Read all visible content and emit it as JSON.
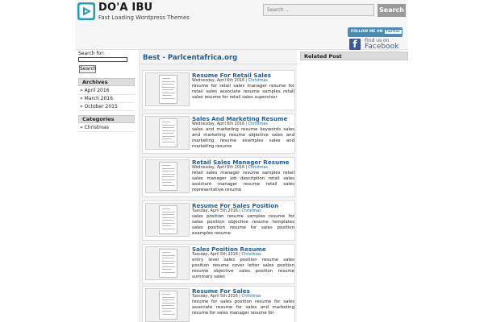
{
  "header": {
    "site_title": "DO'A IBU",
    "tagline": "Fast Loading Wordpress Themes",
    "search_placeholder": "Search ...",
    "search_button": "Search",
    "twitter_follow": "FOLLOW ME ON",
    "twitter_brand": "twitter",
    "facebook_findus": "Find us on",
    "facebook_word": "Facebook",
    "facebook_letter": "f"
  },
  "sidebar_left": {
    "search_label": "Search for:",
    "search_button": "Search",
    "archives": {
      "title": "Archives",
      "items": [
        "» April 2016",
        "» March 2016",
        "» October 2015"
      ]
    },
    "categories": {
      "title": "Categories",
      "items": [
        "» Christmas"
      ]
    }
  },
  "main": {
    "title": "Best - Parlcentafrica.org",
    "posts": [
      {
        "title": "Resume For Retail Sales",
        "date": "Wednesday, April 6th 2016",
        "category": "Christmas",
        "excerpt": "resume for retail sales manager resume for retail sales associate resume samples retail sales resume for retail sales supervisor"
      },
      {
        "title": "Sales And Marketing Resume",
        "date": "Wednesday, April 6th 2016",
        "category": "Christmas",
        "excerpt": "sales and marketing resume keywords sales and marketing resume objective sales and marketing resume examples sales and marketing resume"
      },
      {
        "title": "Retail Sales Manager Resume",
        "date": "Wednesday, April 6th 2016",
        "category": "Christmas",
        "excerpt": "retail sales manager resume samples retail sales manager job description retail sales assistant manager resume retail sales representative resume"
      },
      {
        "title": "Resume For Sales Position",
        "date": "Tuesday, April 5th 2016",
        "category": "Christmas",
        "excerpt": "sales position resume samples resume for sales position objective resume templates sales position resume for sales position examples resume"
      },
      {
        "title": "Sales Position Resume",
        "date": "Tuesday, April 5th 2016",
        "category": "Christmas",
        "excerpt": "entry level sales position resume sales position resume cover letter sales position resume objective sales position resume summary sales"
      },
      {
        "title": "Resume For Sales",
        "date": "Tuesday, April 5th 2016",
        "category": "Christmas",
        "excerpt": "resume for sales position resume for sales associate resume for sales and marketing resume for sales manager resume for"
      }
    ]
  },
  "sidebar_right": {
    "related_title": "Related Post"
  },
  "colors": {
    "link_blue": "#1b5d9c",
    "facebook_blue": "#3b5998",
    "twitter_blue": "#4a8bb5",
    "logo_teal": "#1e9fb8"
  },
  "icons": {
    "logo": "play-triangle-logo-icon",
    "facebook": "facebook-icon"
  }
}
